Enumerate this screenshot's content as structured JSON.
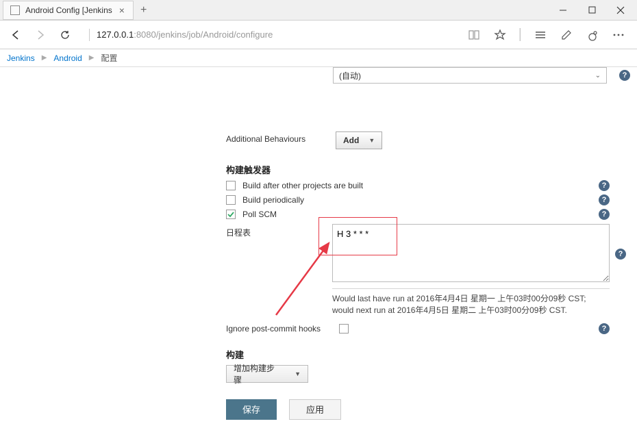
{
  "browser": {
    "tab_title": "Android Config [Jenkins",
    "url_host": "127.0.0.1",
    "url_port_path": ":8080/jenkins/job/Android/configure"
  },
  "breadcrumb": {
    "items": [
      "Jenkins",
      "Android",
      "配置"
    ]
  },
  "form": {
    "select_value": "(自动)",
    "additional_behaviours_label": "Additional Behaviours",
    "add_btn": "Add",
    "triggers_section": "构建触发器",
    "triggers": {
      "build_after": {
        "label": "Build after other projects are built",
        "checked": false
      },
      "build_periodically": {
        "label": "Build periodically",
        "checked": false
      },
      "poll_scm": {
        "label": "Poll SCM",
        "checked": true
      }
    },
    "schedule_label": "日程表",
    "schedule_value": "H 3 * * *",
    "schedule_info": "Would last have run at 2016年4月4日 星期一 上午03时00分09秒 CST; would next run at 2016年4月5日 星期二 上午03时00分09秒 CST.",
    "ignore_label": "Ignore post-commit hooks",
    "ignore_checked": false,
    "build_section": "构建",
    "build_dd_label": "增加构建步骤",
    "save_btn": "保存",
    "apply_btn": "应用"
  }
}
